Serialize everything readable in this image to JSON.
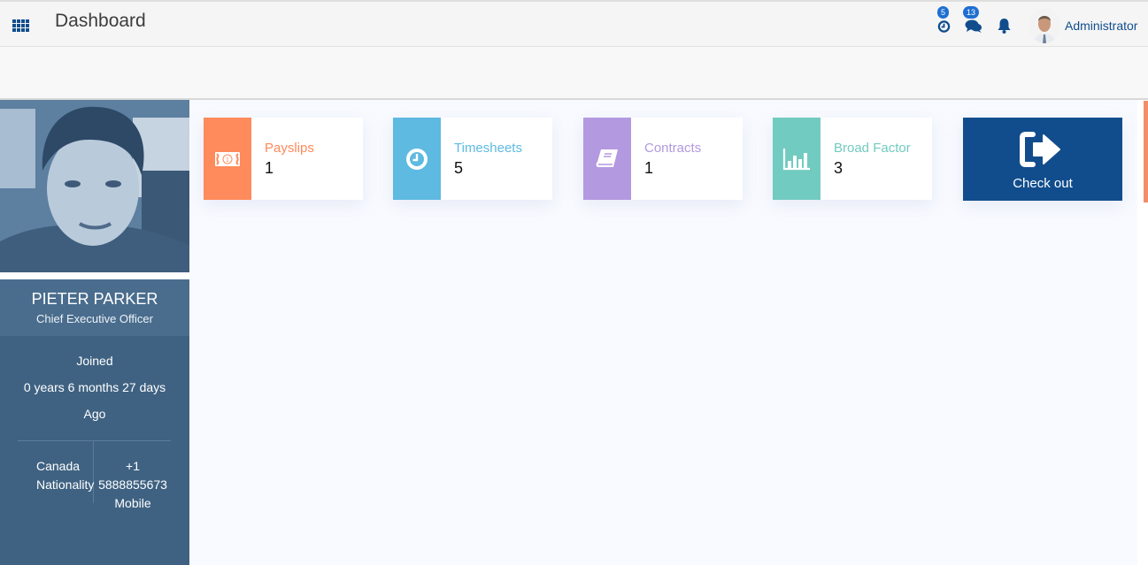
{
  "header": {
    "title": "Dashboard",
    "menu_icon": "apps-grid-icon",
    "clock_badge": "5",
    "chat_badge": "13",
    "user_name": "Administrator"
  },
  "colors": {
    "brand": "#114d8c",
    "payslips": "#ff8a5b",
    "timesheets": "#5ebae1",
    "contracts": "#b399e0",
    "broad_factor": "#72cbc0",
    "sidebar": "#3f6282"
  },
  "profile": {
    "name": "PIETER PARKER",
    "role": "Chief Executive Officer",
    "joined_label": "Joined",
    "tenure": "0 years 6 months 27 days",
    "ago": "Ago",
    "nationality_value": "Canada",
    "nationality_label": "Nationality",
    "mobile_code": "+1",
    "mobile_number": "5888855673",
    "mobile_label": "Mobile"
  },
  "cards": [
    {
      "label": "Payslips",
      "count": "1",
      "icon": "money-bill-icon"
    },
    {
      "label": "Timesheets",
      "count": "5",
      "icon": "clock-icon"
    },
    {
      "label": "Contracts",
      "count": "1",
      "icon": "book-icon"
    },
    {
      "label": "Broad Factor",
      "count": "3",
      "icon": "bar-chart-icon"
    }
  ],
  "checkout": {
    "label": "Check out",
    "icon": "sign-out-icon"
  }
}
